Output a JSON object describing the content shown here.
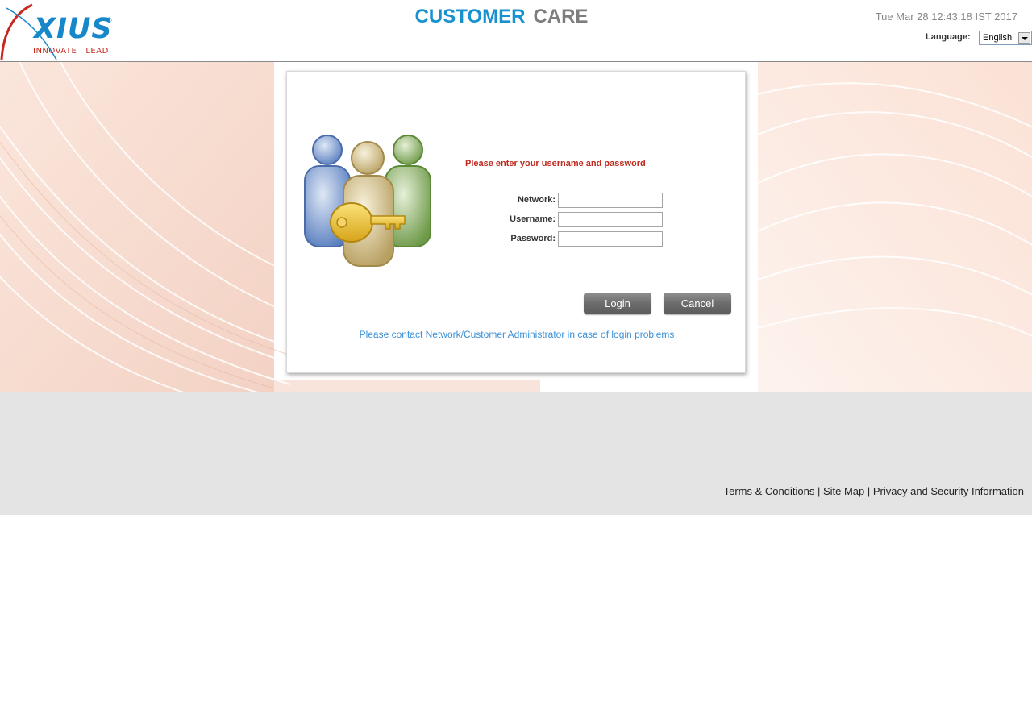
{
  "brand": {
    "logo_text": "XIUS",
    "registered_mark": "®",
    "tagline": "INNOVATE . LEAD."
  },
  "header": {
    "title_part1": "CUSTOMER",
    "title_part2": "CARE",
    "datetime": "Tue Mar 28 12:43:18 IST 2017",
    "language_label": "Language:",
    "language_value": "English"
  },
  "login": {
    "prompt": "Please enter your username and password",
    "network_label": "Network:",
    "username_label": "Username:",
    "password_label": "Password:",
    "network_value": "",
    "username_value": "",
    "password_value": "",
    "login_button": "Login",
    "cancel_button": "Cancel",
    "contact_text": "Please contact Network/Customer Administrator in case of login problems"
  },
  "footer": {
    "terms": "Terms & Conditions",
    "sitemap": "Site Map",
    "privacy": "Privacy and Security Information",
    "separator": " | "
  },
  "colors": {
    "title_blue": "#1792cf",
    "title_grey": "#7d7d7d",
    "prompt_red": "#c0281c",
    "link_blue": "#3a8fd5",
    "footer_bg": "#e4e4e4"
  }
}
